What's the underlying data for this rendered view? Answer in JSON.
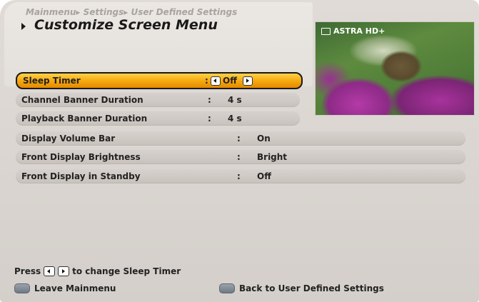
{
  "header": {
    "breadcrumb": "Mainmenu▸ Settings▸ User Defined Settings",
    "title": "Customize Screen Menu"
  },
  "preview": {
    "channel": "ASTRA HD+"
  },
  "menu": {
    "items": [
      {
        "label": "Sleep Timer",
        "value": "Off",
        "selected": true
      },
      {
        "label": "Channel Banner Duration",
        "value": "4 s"
      },
      {
        "label": "Playback Banner Duration",
        "value": "4 s"
      },
      {
        "label": "Display Volume Bar",
        "value": "On"
      },
      {
        "label": "Front Display Brightness",
        "value": "Bright"
      },
      {
        "label": "Front Display in Standby",
        "value": "Off"
      }
    ],
    "separator": ":"
  },
  "help": {
    "press": "Press",
    "action": "to change Sleep Timer"
  },
  "footer": {
    "leave_label": "Leave Mainmenu",
    "back_label": "Back to User Defined Settings"
  },
  "colors": {
    "highlight": "#f5a60c",
    "row": "#cfc9c4",
    "background": "#dcd7d2"
  }
}
